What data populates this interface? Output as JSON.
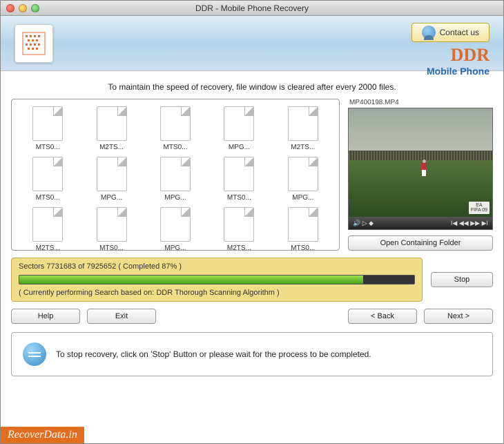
{
  "window": {
    "title": "DDR - Mobile Phone Recovery"
  },
  "header": {
    "contact_label": "Contact us",
    "brand": "DDR",
    "brand_sub": "Mobile Phone"
  },
  "info_line": "To maintain the speed of recovery, file window is cleared after every 2000 files.",
  "files": [
    {
      "name": "MTS0..."
    },
    {
      "name": "M2TS..."
    },
    {
      "name": "MTS0..."
    },
    {
      "name": "MPG..."
    },
    {
      "name": "M2TS..."
    },
    {
      "name": "MTS0..."
    },
    {
      "name": "MPG..."
    },
    {
      "name": "MPG..."
    },
    {
      "name": "MTS0..."
    },
    {
      "name": "MPG..."
    },
    {
      "name": "M2TS..."
    },
    {
      "name": "MTS0..."
    },
    {
      "name": "MPG..."
    },
    {
      "name": "M2TS..."
    },
    {
      "name": "MTS0..."
    }
  ],
  "preview": {
    "filename": "MP400198.MP4",
    "badge_logo": "EA",
    "badge_title": "FIFA 09"
  },
  "open_folder_label": "Open Containing Folder",
  "progress": {
    "sectors_line": "Sectors 7731683 of 7925652    ( Completed 87% )",
    "percent": 87,
    "algo_line": "( Currently performing Search based on: DDR Thorough Scanning Algorithm )"
  },
  "buttons": {
    "stop": "Stop",
    "help": "Help",
    "exit": "Exit",
    "back": "< Back",
    "next": "Next >"
  },
  "hint": "To stop recovery, click on 'Stop' Button or please wait for the process to be completed.",
  "watermark": "RecoverData.in"
}
